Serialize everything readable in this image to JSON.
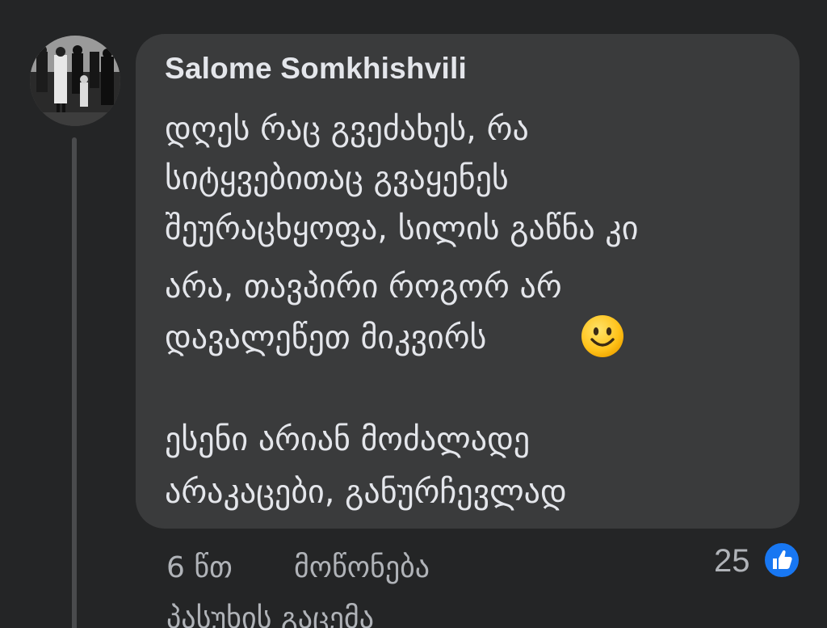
{
  "comment": {
    "author": "Salome Somkhishvili",
    "lines": [
      "დღეს რაც გვეძახეს, რა",
      "სიტყვებითაც გვაყენეს",
      "შეურაცხყოფა, სილის გაწნა კი",
      "არა, თავპირი როგორ არ",
      "დავალეწეთ მიკვირს"
    ],
    "emoji": "slightly-smiling-face",
    "lines_2": [
      "ესენი არიან მოძალადე",
      "არაკაცები, განურჩევლად"
    ]
  },
  "actions": {
    "time": "6 წთ",
    "like": "მოწონება",
    "reply": "პასუხის გაცემა"
  },
  "reactions": {
    "count": "25",
    "icon": "like-thumbs-up-icon",
    "color": "#1877f2"
  },
  "colors": {
    "background": "#242526",
    "bubble": "#3a3b3c",
    "text": "#e4e6eb",
    "secondary_text": "#b0b3b8"
  }
}
